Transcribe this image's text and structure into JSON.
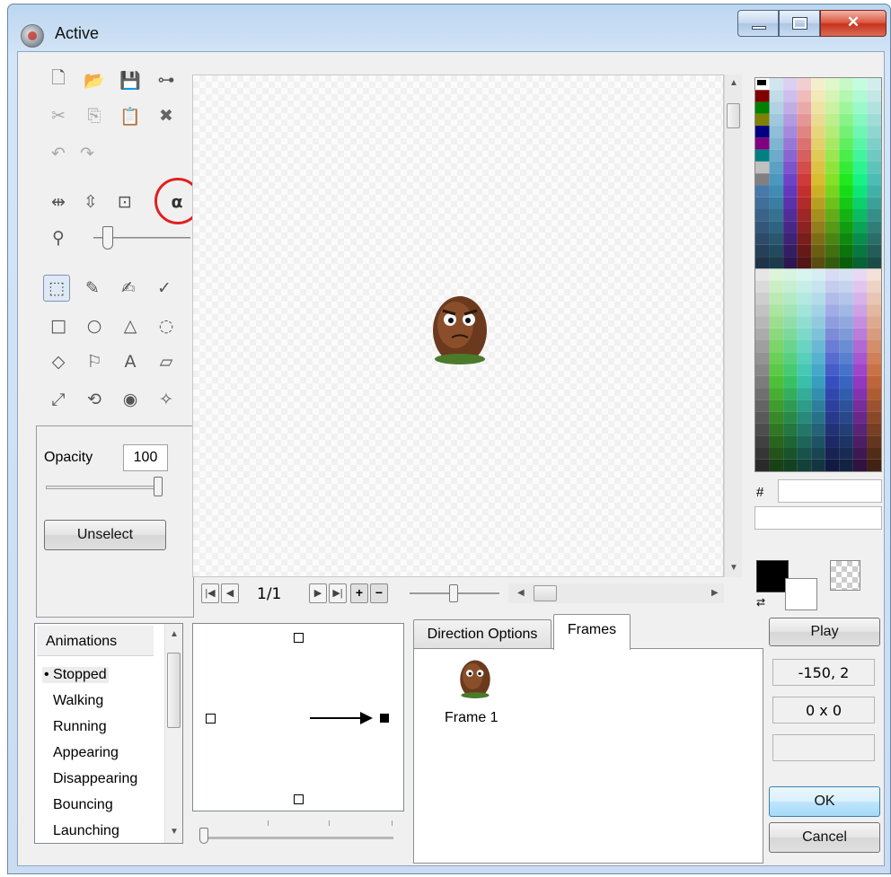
{
  "window": {
    "title": "Active"
  },
  "toolbar": {
    "file_icons": [
      "new-file-icon",
      "open-folder-icon",
      "save-icon",
      "link-icon"
    ],
    "edit_icons": [
      "cut-icon",
      "copy-icon",
      "paste-icon",
      "delete-icon"
    ],
    "history_icons": [
      "undo-icon",
      "redo-icon"
    ],
    "transform_icons": [
      "flip-horizontal-icon",
      "flip-vertical-icon",
      "resize-icon",
      "alpha-channel-icon"
    ],
    "drawing_tools": [
      "rectangle-select-icon",
      "eyedropper-icon",
      "pen-icon",
      "brush-icon",
      "rectangle-icon",
      "ellipse-icon",
      "polygon-icon",
      "shape-icon",
      "fill-bucket-icon",
      "spray-icon",
      "text-tool-icon",
      "eraser-icon",
      "hotspot-line-icon",
      "rotate-icon",
      "view-icon",
      "action-point-icon"
    ],
    "highlighted_tool": "alpha-channel-icon",
    "highlight_color": "#e02020"
  },
  "opacity": {
    "label": "Opacity",
    "value": "100",
    "level": 1.0
  },
  "buttons": {
    "unselect": "Unselect",
    "play": "Play",
    "ok": "OK",
    "cancel": "Cancel"
  },
  "frame_nav": {
    "counter": "1/1"
  },
  "readouts": {
    "hotspot": "-150, 2",
    "size": "0 x 0",
    "extra": ""
  },
  "color_inputs": {
    "hex_label": "#",
    "hex_value": "",
    "color_name": ""
  },
  "colors": {
    "foreground": "#000000",
    "background": "#ffffff"
  },
  "animations": {
    "header": "Animations",
    "items": [
      "Stopped",
      "Walking",
      "Running",
      "Appearing",
      "Disappearing",
      "Bouncing",
      "Launching"
    ],
    "selected": "Stopped"
  },
  "tabs": {
    "items": [
      "Direction Options",
      "Frames"
    ],
    "active": "Frames"
  },
  "frames": [
    {
      "label": "Frame 1"
    }
  ]
}
